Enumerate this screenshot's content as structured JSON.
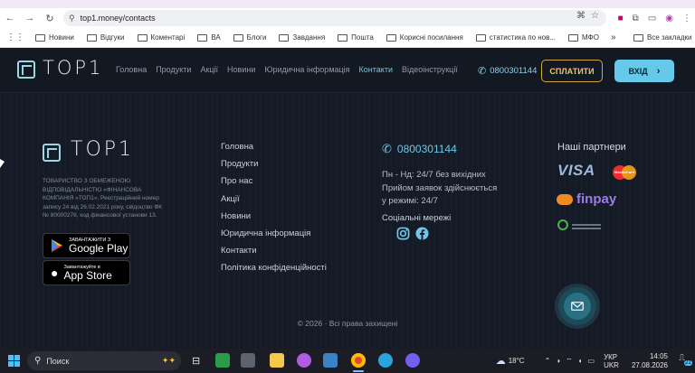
{
  "browser": {
    "url": "top1.money/contacts",
    "bookmarks": [
      "Новини",
      "Відгуки",
      "Коментарі",
      "ВА",
      "Блоги",
      "Завдання",
      "Пошта",
      "Корисні посилання",
      "статистика по нов...",
      "МФО"
    ],
    "all_bookmarks": "Все закладки",
    "more": "»"
  },
  "site": {
    "logo": "TOP1",
    "nav": [
      "Головна",
      "Продукти",
      "Акції",
      "Новини",
      "Юридична інформація",
      "Контакти",
      "Відеоінструкції"
    ],
    "nav_active": "Контакти",
    "phone": "0800301144",
    "pay_label": "СПЛАТИТИ",
    "login_label": "ВХІД"
  },
  "footer": {
    "company": "ТОВАРИСТВО З ОБМЕЖЕНОЮ ВІДПОВІДАЛЬНІСТЮ «ФІНАНСОВА КОМПАНІЯ «ТОП1». Реєстраційний номер запису 24 від 26.02.2021 року, свідоцтво ФК № 80000276, код фінансової установи 13.",
    "google_play": {
      "small": "ЗАВАНТАЖИТИ З",
      "big": "Google Play"
    },
    "app_store": {
      "small": "Завантажуйте в",
      "big": "App Store"
    },
    "links": [
      "Головна",
      "Продукти",
      "Про нас",
      "Акції",
      "Новини",
      "Юридична інформація",
      "Контакти",
      "Політика конфіденційності"
    ],
    "phone": "0800301144",
    "hours": [
      "Пн - Нд: 24/7 без вихідних",
      "Прийом заявок здійснюється",
      "у режимі: 24/7"
    ],
    "social_title": "Соціальні мережі",
    "partners_title": "Наші партнери",
    "partners": {
      "visa": "VISA",
      "mastercard": "MasterCard",
      "finpay": "finpay"
    },
    "copyright": "© 2026 · Всі права захищені"
  },
  "taskbar": {
    "search": "Поиск",
    "weather": "18°C",
    "lang": [
      "УКР",
      "UKR"
    ],
    "time": "14:05",
    "date": "27.08.2026",
    "notifications": "21"
  }
}
